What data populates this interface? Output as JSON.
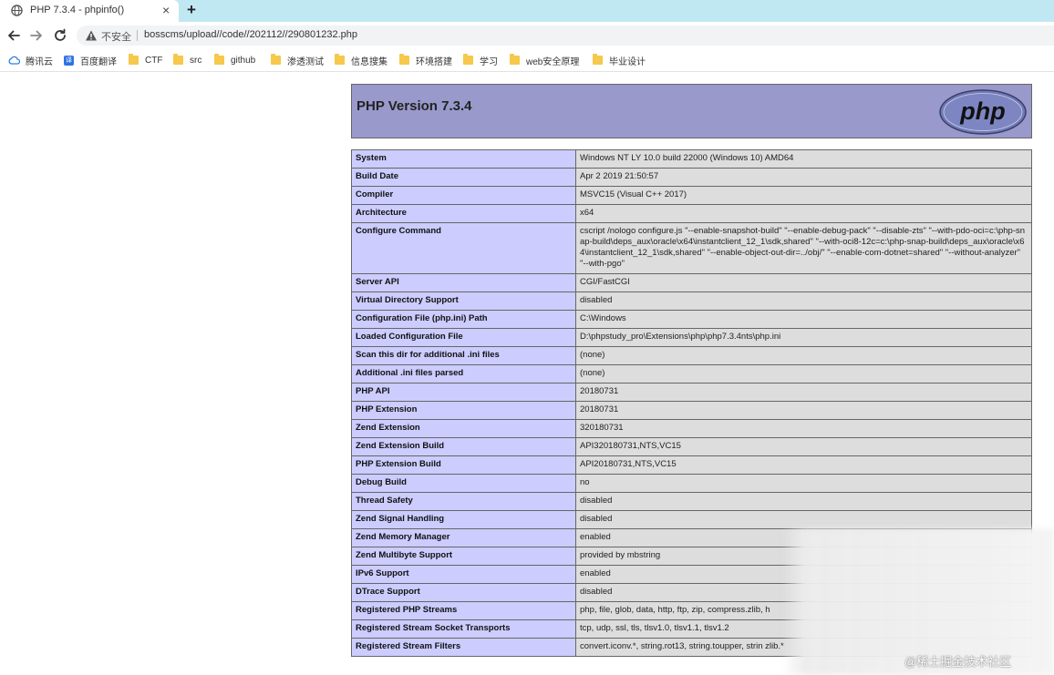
{
  "tab": {
    "title": "PHP 7.3.4 - phpinfo()",
    "close": "×",
    "new_tab": "+"
  },
  "toolbar": {
    "back_icon": "arrow-left-icon",
    "forward_icon": "arrow-right-icon",
    "reload_icon": "reload-icon",
    "security_label": "不安全",
    "url": "bosscms/upload//code//202112//290801232.php"
  },
  "bookmarks": [
    {
      "label": "腾讯云",
      "icon": "cloud-icon"
    },
    {
      "label": "百度翻译",
      "icon": "translate-icon"
    },
    {
      "label": "CTF",
      "icon": "folder-icon"
    },
    {
      "label": "src",
      "icon": "folder-icon"
    },
    {
      "label": "github",
      "icon": "folder-icon"
    },
    {
      "label": "渗透测试",
      "icon": "folder-icon"
    },
    {
      "label": "信息搜集",
      "icon": "folder-icon"
    },
    {
      "label": "环境搭建",
      "icon": "folder-icon"
    },
    {
      "label": "学习",
      "icon": "folder-icon"
    },
    {
      "label": "web安全原理",
      "icon": "folder-icon"
    },
    {
      "label": "毕业设计",
      "icon": "folder-icon"
    }
  ],
  "phpinfo": {
    "version_title": "PHP Version 7.3.4",
    "logo_text": "php",
    "rows": [
      {
        "key": "System",
        "value": "Windows NT LY 10.0 build 22000 (Windows 10) AMD64"
      },
      {
        "key": "Build Date",
        "value": "Apr 2 2019 21:50:57"
      },
      {
        "key": "Compiler",
        "value": "MSVC15 (Visual C++ 2017)"
      },
      {
        "key": "Architecture",
        "value": "x64"
      },
      {
        "key": "Configure Command",
        "value": "cscript /nologo configure.js \"--enable-snapshot-build\" \"--enable-debug-pack\" \"--disable-zts\" \"--with-pdo-oci=c:\\php-snap-build\\deps_aux\\oracle\\x64\\instantclient_12_1\\sdk,shared\" \"--with-oci8-12c=c:\\php-snap-build\\deps_aux\\oracle\\x64\\instantclient_12_1\\sdk,shared\" \"--enable-object-out-dir=../obj/\" \"--enable-com-dotnet=shared\" \"--without-analyzer\" \"--with-pgo\""
      },
      {
        "key": "Server API",
        "value": "CGI/FastCGI"
      },
      {
        "key": "Virtual Directory Support",
        "value": "disabled"
      },
      {
        "key": "Configuration File (php.ini) Path",
        "value": "C:\\Windows"
      },
      {
        "key": "Loaded Configuration File",
        "value": "D:\\phpstudy_pro\\Extensions\\php\\php7.3.4nts\\php.ini"
      },
      {
        "key": "Scan this dir for additional .ini files",
        "value": "(none)"
      },
      {
        "key": "Additional .ini files parsed",
        "value": "(none)"
      },
      {
        "key": "PHP API",
        "value": "20180731"
      },
      {
        "key": "PHP Extension",
        "value": "20180731"
      },
      {
        "key": "Zend Extension",
        "value": "320180731"
      },
      {
        "key": "Zend Extension Build",
        "value": "API320180731,NTS,VC15"
      },
      {
        "key": "PHP Extension Build",
        "value": "API20180731,NTS,VC15"
      },
      {
        "key": "Debug Build",
        "value": "no"
      },
      {
        "key": "Thread Safety",
        "value": "disabled"
      },
      {
        "key": "Zend Signal Handling",
        "value": "disabled"
      },
      {
        "key": "Zend Memory Manager",
        "value": "enabled"
      },
      {
        "key": "Zend Multibyte Support",
        "value": "provided by mbstring"
      },
      {
        "key": "IPv6 Support",
        "value": "enabled"
      },
      {
        "key": "DTrace Support",
        "value": "disabled"
      },
      {
        "key": "Registered PHP Streams",
        "value": "php, file, glob, data, http, ftp, zip, compress.zlib, h"
      },
      {
        "key": "Registered Stream Socket Transports",
        "value": "tcp, udp, ssl, tls, tlsv1.0, tlsv1.1, tlsv1.2"
      },
      {
        "key": "Registered Stream Filters",
        "value": "convert.iconv.*, string.rot13, string.toupper, strin zlib.*"
      }
    ]
  },
  "watermark": "@稀土掘金技术社区",
  "colors": {
    "header_bg": "#9999cc",
    "key_bg": "#ccccff",
    "value_bg": "#dddddd",
    "tabstrip_bg": "#bfe8f3",
    "bookmark_folder": "#f6c84b"
  }
}
